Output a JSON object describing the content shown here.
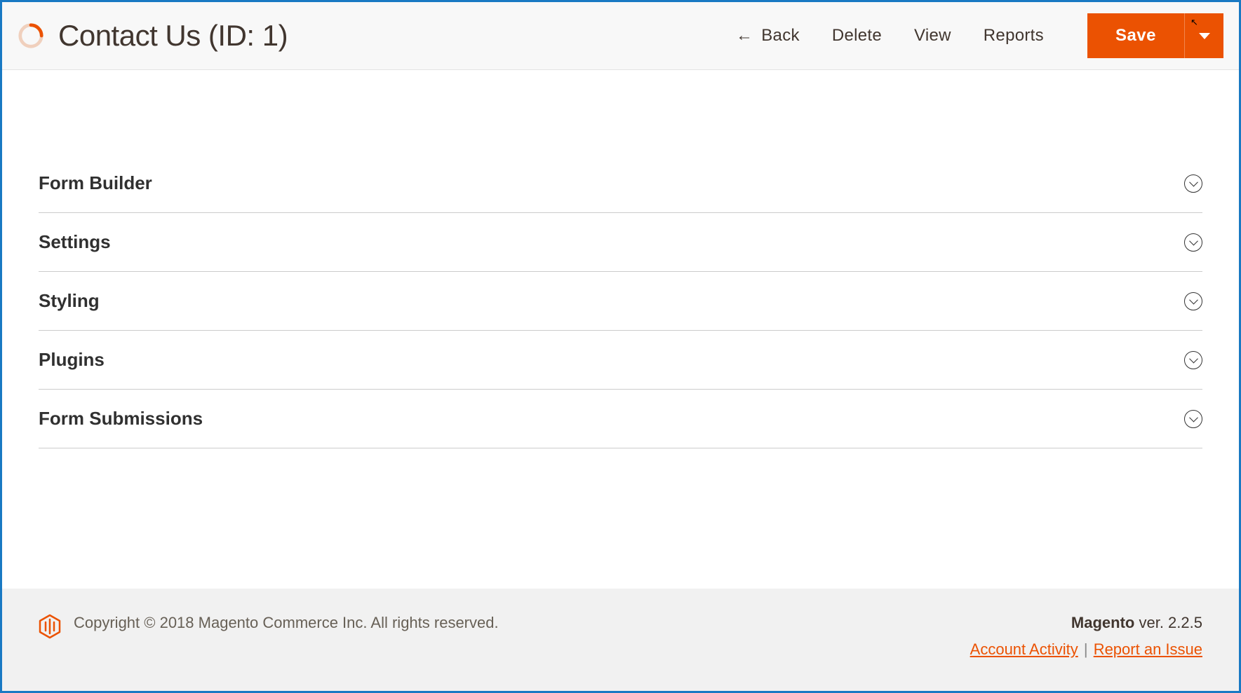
{
  "header": {
    "page_title": "Contact Us (ID: 1)",
    "actions": {
      "back": "Back",
      "delete": "Delete",
      "view": "View",
      "reports": "Reports",
      "save": "Save"
    }
  },
  "sections": [
    {
      "title": "Form Builder"
    },
    {
      "title": "Settings"
    },
    {
      "title": "Styling"
    },
    {
      "title": "Plugins"
    },
    {
      "title": "Form Submissions"
    }
  ],
  "footer": {
    "copyright": "Copyright © 2018 Magento Commerce Inc. All rights reserved.",
    "brand": "Magento",
    "version": " ver. 2.2.5",
    "links": {
      "account_activity": "Account Activity",
      "report_issue": "Report an Issue"
    }
  }
}
